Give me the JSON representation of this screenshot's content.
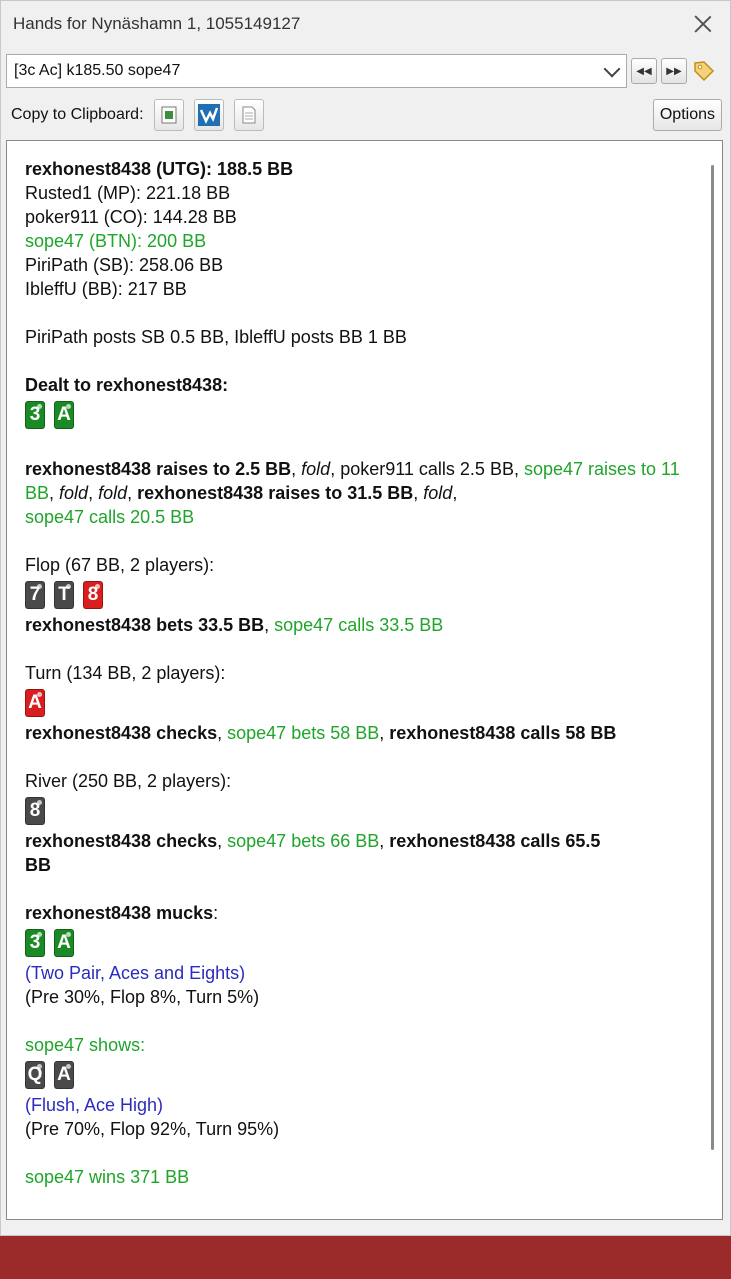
{
  "window": {
    "title": "Hands for Nynäshamn 1, 1055149127"
  },
  "hand_select": {
    "value": "[3c Ac] k185.50 sope47"
  },
  "toolbar": {
    "copy_label": "Copy to Clipboard:",
    "options_label": "Options"
  },
  "hand": {
    "players": [
      {
        "text": "rexhonest8438 (UTG): 188.5 BB",
        "style": "b"
      },
      {
        "text": "Rusted1 (MP): 221.18 BB",
        "style": ""
      },
      {
        "text": "poker911 (CO): 144.28 BB",
        "style": ""
      },
      {
        "text": "sope47 (BTN): 200 BB",
        "style": "g"
      },
      {
        "text": "PiriPath (SB): 258.06 BB",
        "style": ""
      },
      {
        "text": "IbleffU (BB): 217 BB",
        "style": ""
      }
    ],
    "blinds": "PiriPath posts SB 0.5 BB, IbleffU posts BB 1 BB",
    "dealt_label": "Dealt to rexhonest8438:",
    "hole_cards": [
      {
        "rank": "3",
        "color": "green"
      },
      {
        "rank": "A",
        "color": "green"
      }
    ],
    "preflop": [
      {
        "text": "rexhonest8438 raises to 2.5 BB",
        "style": "b"
      },
      {
        "text": ", ",
        "style": ""
      },
      {
        "text": "fold",
        "style": "i"
      },
      {
        "text": ", poker911 calls 2.5 BB, ",
        "style": ""
      },
      {
        "text": "sope47 raises to 11 BB",
        "style": "g"
      },
      {
        "text": ", ",
        "style": ""
      },
      {
        "text": "fold",
        "style": "i"
      },
      {
        "text": ", ",
        "style": ""
      },
      {
        "text": "fold",
        "style": "i"
      },
      {
        "text": ", ",
        "style": ""
      },
      {
        "text": "rexhonest8438 raises to 31.5 BB",
        "style": "b"
      },
      {
        "text": ", ",
        "style": ""
      },
      {
        "text": "fold",
        "style": "i"
      },
      {
        "text": ",",
        "style": ""
      },
      {
        "text": "sope47 calls 20.5 BB",
        "style": "g",
        "newline": true
      }
    ],
    "flop": {
      "label": "Flop (67 BB, 2 players):",
      "cards": [
        {
          "rank": "7",
          "color": "dark"
        },
        {
          "rank": "T",
          "color": "dark"
        },
        {
          "rank": "8",
          "color": "red"
        }
      ],
      "actions": [
        {
          "text": "rexhonest8438 bets 33.5 BB",
          "style": "b"
        },
        {
          "text": ", ",
          "style": ""
        },
        {
          "text": "sope47 calls 33.5 BB",
          "style": "g"
        }
      ]
    },
    "turn": {
      "label": "Turn (134 BB, 2 players):",
      "cards": [
        {
          "rank": "A",
          "color": "red"
        }
      ],
      "actions": [
        {
          "text": "rexhonest8438 checks",
          "style": "b"
        },
        {
          "text": ", ",
          "style": ""
        },
        {
          "text": "sope47 bets 58 BB",
          "style": "g"
        },
        {
          "text": ", ",
          "style": ""
        },
        {
          "text": "rexhonest8438 calls 58 BB",
          "style": "b"
        }
      ]
    },
    "river": {
      "label": "River (250 BB, 2 players):",
      "cards": [
        {
          "rank": "8",
          "color": "dark"
        }
      ],
      "actions": [
        {
          "text": "rexhonest8438 checks",
          "style": "b"
        },
        {
          "text": ", ",
          "style": ""
        },
        {
          "text": "sope47 bets 66 BB",
          "style": "g"
        },
        {
          "text": ", ",
          "style": ""
        },
        {
          "text": "rexhonest8438 calls 65.5",
          "style": "b"
        },
        {
          "text": "BB",
          "style": "b",
          "newline": true
        }
      ]
    },
    "showdown1": {
      "name": "rexhonest8438 mucks",
      "suffix": ":",
      "cards": [
        {
          "rank": "3",
          "color": "green"
        },
        {
          "rank": "A",
          "color": "green"
        }
      ],
      "hand": "(Two Pair, Aces and Eights)",
      "equity": "(Pre 30%, Flop 8%, Turn 5%)"
    },
    "showdown2": {
      "name": "sope47 shows:",
      "cards": [
        {
          "rank": "Q",
          "color": "dark"
        },
        {
          "rank": "A",
          "color": "dark"
        }
      ],
      "hand": "(Flush, Ace High)",
      "equity": "(Pre 70%, Flop 92%, Turn 95%)"
    },
    "result": "sope47 wins 371 BB"
  }
}
